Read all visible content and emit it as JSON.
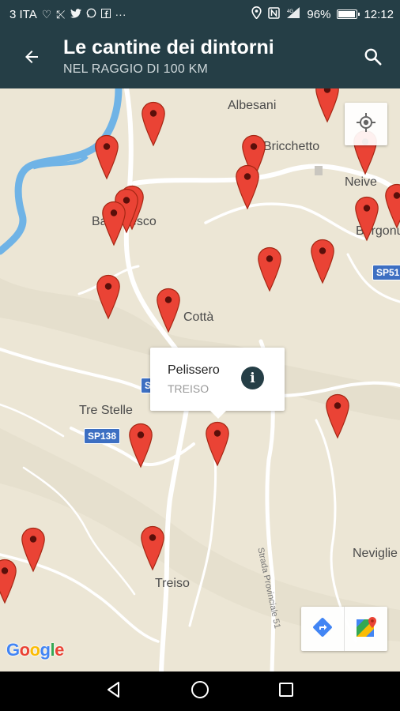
{
  "status_bar": {
    "carrier": "3 ITA",
    "battery_percent": "96%",
    "battery_level": 0.96,
    "time": "12:12",
    "left_icons": [
      "heart-icon",
      "missed-call-icon",
      "twitter-icon",
      "whatsapp-icon",
      "facebook-icon",
      "more-icon"
    ],
    "right_icons": [
      "location-icon",
      "nfc-icon",
      "signal-icon",
      "battery-icon"
    ]
  },
  "app_bar": {
    "title": "Le cantine dei dintorni",
    "subtitle": "NEL RAGGIO DI 100 KM",
    "back_icon": "arrow-back-icon",
    "search_icon": "search-icon"
  },
  "map": {
    "places": [
      "Albesani",
      "Bricchetto",
      "Neive",
      "Barbaresco",
      "Borgonuovo",
      "Cottà",
      "Tre Stelle",
      "Treiso",
      "Neviglie",
      "Strada Provinciale 51"
    ],
    "road_shields": [
      "SP51",
      "SP138",
      "SP"
    ],
    "colors": {
      "land": "#ece6d5",
      "river": "#6fb3e6",
      "road": "#ffffff",
      "pin": "#ea4335",
      "pin_dark": "#a52714"
    },
    "info_window": {
      "name": "Pelissero",
      "place": "TREISO",
      "icon": "info-icon"
    },
    "locate_icon": "my-location-icon",
    "tools": [
      "directions-icon",
      "google-maps-icon"
    ],
    "logo": "Google"
  },
  "nav_bar": [
    "back-triangle-icon",
    "home-circle-icon",
    "recents-square-icon"
  ]
}
